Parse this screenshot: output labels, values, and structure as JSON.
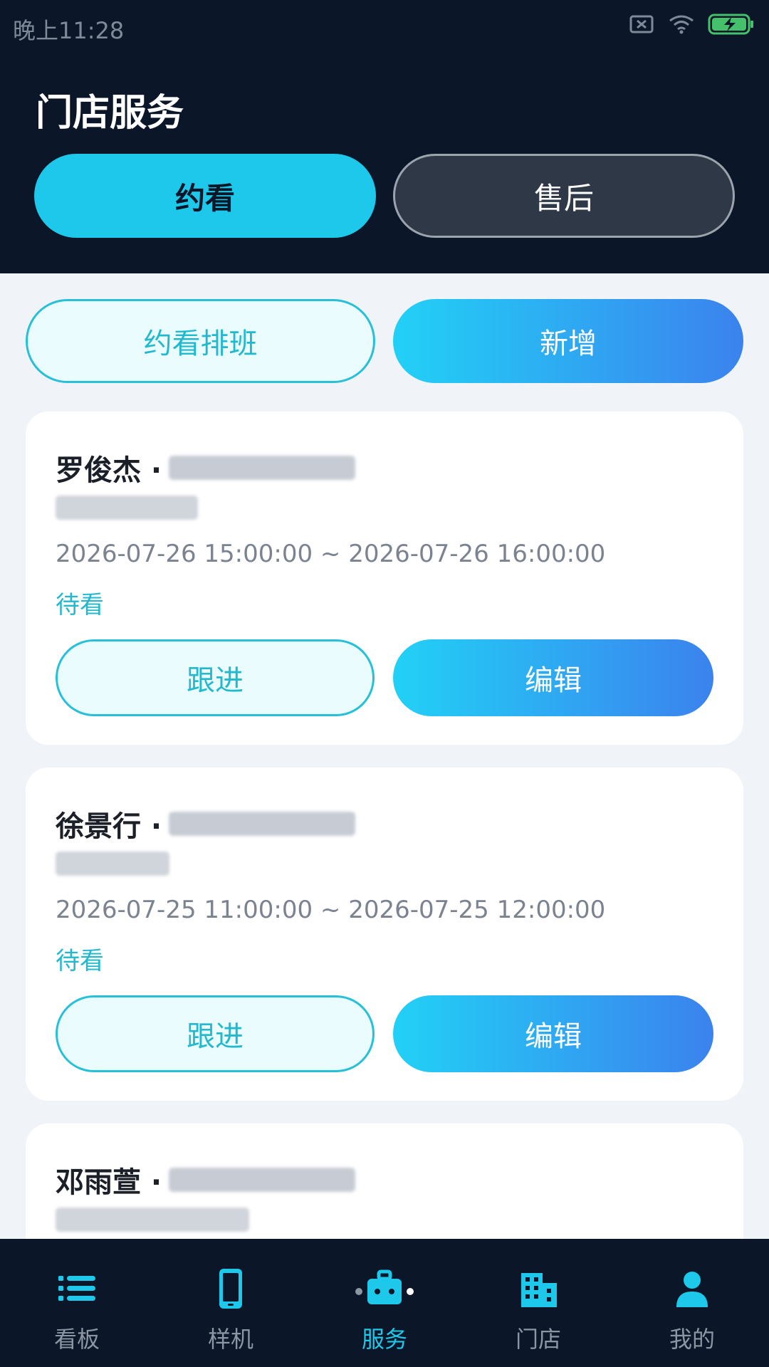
{
  "statusbar": {
    "time": "晚上11:28"
  },
  "header": {
    "title": "门店服务"
  },
  "tabs": [
    {
      "label": "约看"
    },
    {
      "label": "售后"
    }
  ],
  "actions": {
    "schedule_label": "约看排班",
    "add_label": "新增"
  },
  "cards": [
    {
      "name": "罗俊杰 ·",
      "time": "2026-07-26 15:00:00 ~ 2026-07-26 16:00:00",
      "status": "待看",
      "follow_label": "跟进",
      "edit_label": "编辑"
    },
    {
      "name": "徐景行 ·",
      "time": "2026-07-25 11:00:00 ~ 2026-07-25 12:00:00",
      "status": "待看",
      "follow_label": "跟进",
      "edit_label": "编辑"
    },
    {
      "name": "邓雨萱 ·"
    }
  ],
  "nav": [
    {
      "label": "看板",
      "icon": "list-icon"
    },
    {
      "label": "样机",
      "icon": "phone-icon"
    },
    {
      "label": "服务",
      "icon": "briefcase-icon"
    },
    {
      "label": "门店",
      "icon": "building-icon"
    },
    {
      "label": "我的",
      "icon": "user-icon"
    }
  ],
  "colors": {
    "accent": "#1ec8ea",
    "header_bg": "#0b1628"
  }
}
